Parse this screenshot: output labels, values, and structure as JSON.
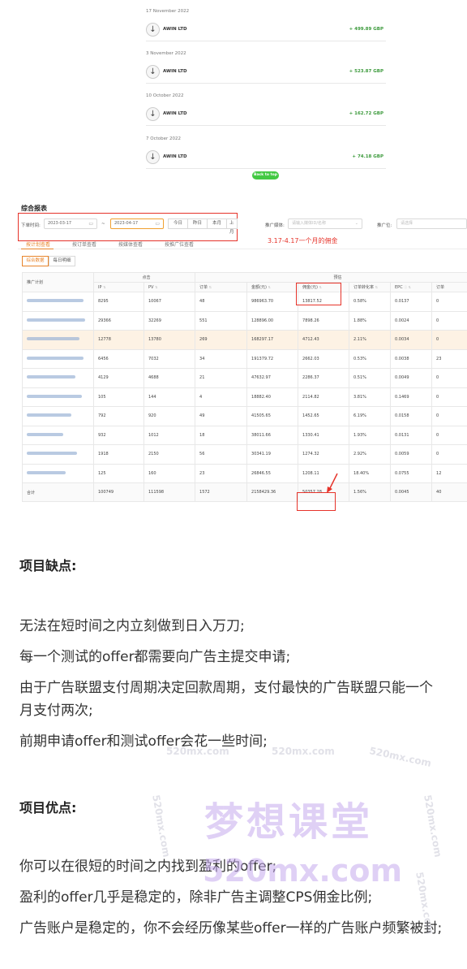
{
  "payments": [
    {
      "date": "17 November 2022",
      "payee": "AWIN LTD",
      "amount": "+ 499.89 GBP"
    },
    {
      "date": "3 November 2022",
      "payee": "AWIN LTD",
      "amount": "+ 523.87 GBP"
    },
    {
      "date": "10 October 2022",
      "payee": "AWIN LTD",
      "amount": "+ 162.72 GBP"
    },
    {
      "date": "7 October 2022",
      "payee": "AWIN LTD",
      "amount": "+ 74.18 GBP"
    }
  ],
  "back_to_top": "Back to top",
  "report": {
    "title": "综合报表",
    "date_label": "下单时间:",
    "start_date": "2023-03-17",
    "range_sep": "~",
    "end_date": "2023-04-17",
    "quick_buttons": [
      "今日",
      "昨日",
      "本月",
      "上月"
    ],
    "media_label": "推广媒体:",
    "media_placeholder": "请输入媒体ID/名称",
    "position_label": "推广位:",
    "position_placeholder": "请选择",
    "annotation": "3.17-4.17一个月的佣金",
    "tabs": [
      "按计划查看",
      "按订单查看",
      "按媒体查看",
      "按推广位查看"
    ],
    "subtabs": [
      "综合数据",
      "每日明细"
    ],
    "group_headers": {
      "click": "点击",
      "estimate": "预估"
    },
    "plan_header": "推广计划",
    "columns": [
      "IP",
      "PV",
      "订单",
      "金额(元)",
      "佣金(元)",
      "订单转化率",
      "EPC",
      "订单"
    ],
    "rows": [
      [
        "8295",
        "10067",
        "48",
        "986963.70",
        "13817.52",
        "0.58%",
        "0.0137",
        "0"
      ],
      [
        "29366",
        "32269",
        "551",
        "128896.00",
        "7898.26",
        "1.88%",
        "0.0024",
        "0"
      ],
      [
        "12778",
        "13780",
        "269",
        "168297.17",
        "4712.43",
        "2.11%",
        "0.0034",
        "0"
      ],
      [
        "6456",
        "7032",
        "34",
        "191379.72",
        "2662.03",
        "0.53%",
        "0.0038",
        "23"
      ],
      [
        "4129",
        "4688",
        "21",
        "47632.97",
        "2286.37",
        "0.51%",
        "0.0049",
        "0"
      ],
      [
        "105",
        "144",
        "4",
        "18882.40",
        "2114.82",
        "3.81%",
        "0.1469",
        "0"
      ],
      [
        "792",
        "920",
        "49",
        "41505.65",
        "1452.65",
        "6.19%",
        "0.0158",
        "0"
      ],
      [
        "932",
        "1012",
        "18",
        "38011.66",
        "1330.41",
        "1.93%",
        "0.0131",
        "0"
      ],
      [
        "1918",
        "2150",
        "56",
        "30341.19",
        "1274.32",
        "2.92%",
        "0.0059",
        "0"
      ],
      [
        "125",
        "160",
        "23",
        "26846.55",
        "1208.11",
        "18.40%",
        "0.0755",
        "12"
      ]
    ],
    "total": {
      "label": "合计",
      "values": [
        "100749",
        "111598",
        "1572",
        "2158429.36",
        "50357.28",
        "1.56%",
        "0.0045",
        "40"
      ]
    }
  },
  "article": {
    "cons_heading": "项目缺点:",
    "cons": [
      "无法在短时间之内立刻做到日入万刀;",
      "每一个测试的offer都需要向广告主提交申请;",
      "由于广告联盟支付周期决定回款周期，支付最快的广告联盟只能一个月支付两次;",
      "前期申请offer和测试offer会花一些时间;"
    ],
    "pros_heading": "项目优点:",
    "pros": [
      "你可以在很短的时间之内找到盈利的offer;",
      "盈利的offer几乎是稳定的，除非广告主调整CPS佣金比例;",
      "广告账户是稳定的，你不会经历像某些offer一样的广告账户频繁被封;"
    ]
  },
  "watermark": {
    "brand": "梦想课堂",
    "domain": "520mx.com"
  }
}
